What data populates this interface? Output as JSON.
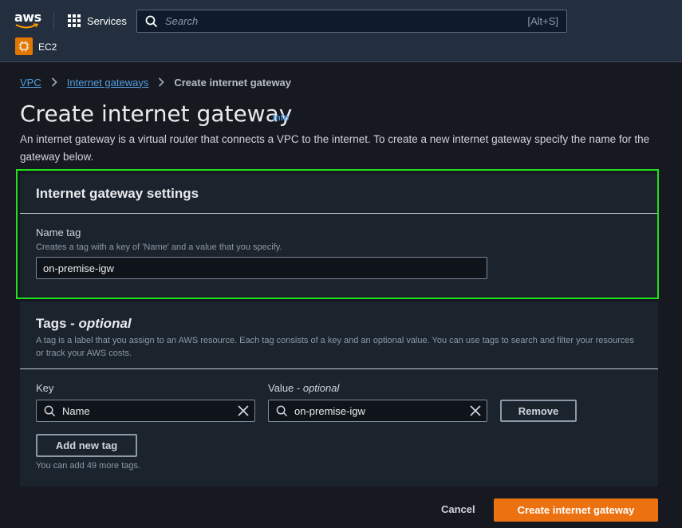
{
  "nav": {
    "logo_text": "aws",
    "services_label": "Services",
    "search_placeholder": "Search",
    "search_shortcut": "[Alt+S]",
    "service_shortcut_label": "EC2"
  },
  "breadcrumb": {
    "items": [
      "VPC",
      "Internet gateways"
    ],
    "current": "Create internet gateway"
  },
  "page": {
    "title": "Create internet gateway",
    "info_label": "Info",
    "description": "An internet gateway is a virtual router that connects a VPC to the internet. To create a new internet gateway specify the name for the gateway below."
  },
  "settings": {
    "heading": "Internet gateway settings",
    "name_tag_label": "Name tag",
    "name_tag_hint": "Creates a tag with a key of 'Name' and a value that you specify.",
    "name_tag_value": "on-premise-igw"
  },
  "tags": {
    "heading_main": "Tags - ",
    "heading_optional": "optional",
    "description": "A tag is a label that you assign to an AWS resource. Each tag consists of a key and an optional value. You can use tags to search and filter your resources or track your AWS costs.",
    "key_label": "Key",
    "value_label_main": "Value - ",
    "value_label_optional": "optional",
    "rows": [
      {
        "key": "Name",
        "value": "on-premise-igw"
      }
    ],
    "remove_label": "Remove",
    "add_label": "Add new tag",
    "remaining_text": "You can add 49 more tags."
  },
  "footer": {
    "cancel_label": "Cancel",
    "submit_label": "Create internet gateway"
  },
  "colors": {
    "nav_bg": "#232f3e",
    "page_bg": "#16191f",
    "panel_bg": "#1b232d",
    "link": "#539fe5",
    "primary": "#ec7211",
    "highlight": "#22e01e"
  }
}
